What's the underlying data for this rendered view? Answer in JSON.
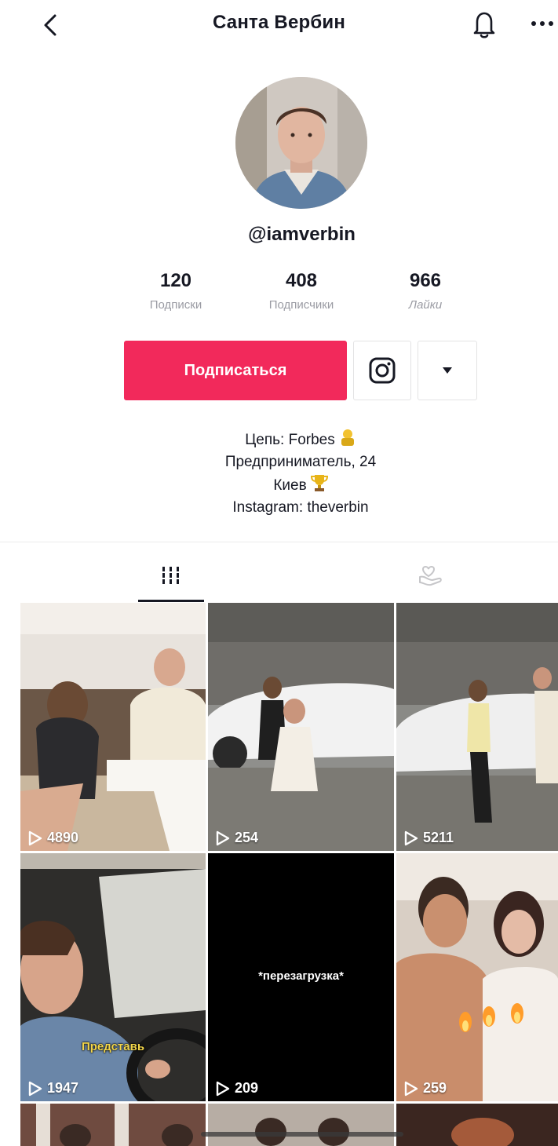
{
  "header": {
    "title": "Санта Вербин",
    "back_icon": "chevron-left-icon",
    "bell_icon": "bell-icon",
    "more_icon": "more-horizontal-icon"
  },
  "profile": {
    "username": "@iamverbin",
    "stats": [
      {
        "value": "120",
        "label": "Подписки"
      },
      {
        "value": "408",
        "label": "Подписчики"
      },
      {
        "value": "966",
        "label": "Лайки"
      }
    ],
    "follow_label": "Подписаться",
    "bio": [
      "Цепь: Forbes",
      "Предприниматель, 24",
      "Киев",
      "Instagram: theverbin"
    ]
  },
  "tabs": [
    {
      "name": "videos",
      "icon": "grid-icon",
      "active": true
    },
    {
      "name": "liked",
      "icon": "heart-hand-icon",
      "active": false
    }
  ],
  "videos": [
    {
      "views": "4890"
    },
    {
      "views": "254"
    },
    {
      "views": "5211"
    },
    {
      "views": "1947",
      "caption": "Представь"
    },
    {
      "views": "209",
      "caption": "*перезагрузка*"
    },
    {
      "views": "259"
    }
  ],
  "colors": {
    "accent": "#f2295b",
    "text": "#161823",
    "muted": "#9a9ba3"
  }
}
